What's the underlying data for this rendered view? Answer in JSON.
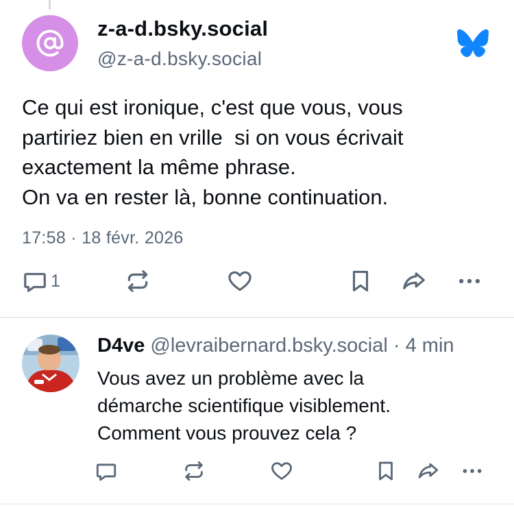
{
  "main_post": {
    "author": {
      "display_name": "z-a-d.bsky.social",
      "handle": "@z-a-d.bsky.social",
      "avatar_icon": "at-sign-icon",
      "avatar_color": "#d68fe6"
    },
    "text": "Ce qui est ironique, c'est que vous, vous\npartiriez bien en vrille  si on vous écrivait\nexactement la même phrase.\nOn va en rester là, bonne continuation.",
    "timestamp": "17:58 · 18 févr. 2026",
    "actions": {
      "reply_count": "1"
    }
  },
  "reply": {
    "display_name": "D4ve",
    "handle": "@levraibernard.bsky.social",
    "separator": "·",
    "time": "4 min",
    "text": "Vous avez un problème avec la\ndémarche scientifique visiblement.\nComment vous prouvez cela ?"
  },
  "colors": {
    "brand_blue": "#1185fe",
    "icon_gray": "#5a6878",
    "text_primary": "#0b0f14"
  }
}
